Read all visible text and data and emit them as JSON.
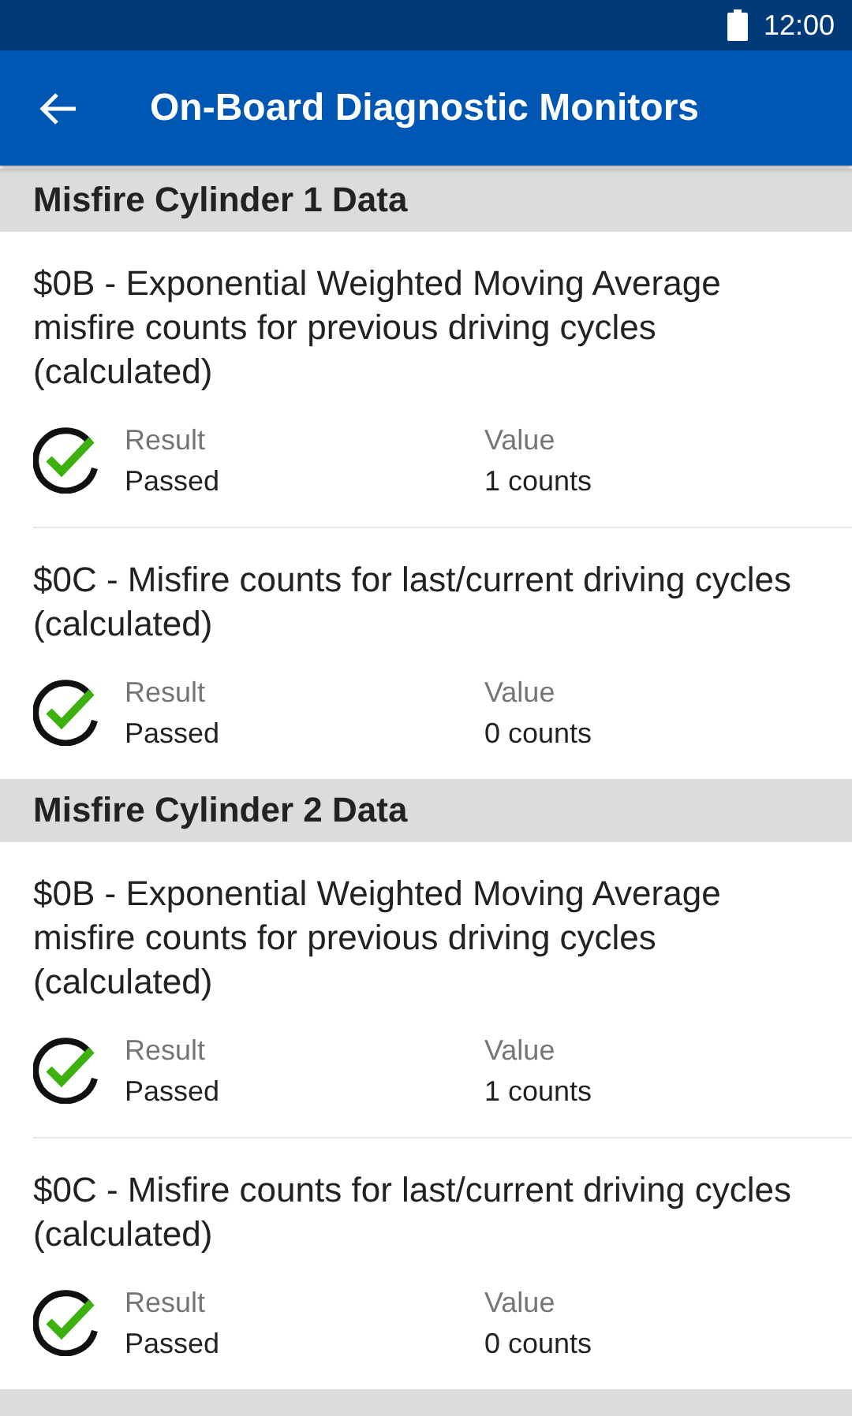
{
  "status_bar": {
    "time": "12:00"
  },
  "app_bar": {
    "title": "On-Board Diagnostic Monitors"
  },
  "sections": [
    {
      "title": "Misfire Cylinder 1 Data",
      "items": [
        {
          "title": "$0B - Exponential Weighted Moving Average misfire counts for previous driving cycles (calculated)",
          "kind": "passed",
          "result_label": "Result",
          "result": "Passed",
          "value_label": "Value",
          "value": "1 counts"
        },
        {
          "title": "$0C - Misfire counts for last/current driving cycles (calculated)",
          "kind": "passed",
          "result_label": "Result",
          "result": "Passed",
          "value_label": "Value",
          "value": "0 counts"
        }
      ]
    },
    {
      "title": "Misfire Cylinder 2 Data",
      "items": [
        {
          "title": "$0B - Exponential Weighted Moving Average misfire counts for previous driving cycles (calculated)",
          "kind": "passed",
          "result_label": "Result",
          "result": "Passed",
          "value_label": "Value",
          "value": "1 counts"
        },
        {
          "title": "$0C - Misfire counts for last/current driving cycles (calculated)",
          "kind": "passed",
          "result_label": "Result",
          "result": "Passed",
          "value_label": "Value",
          "value": "0 counts"
        }
      ]
    },
    {
      "kind": "cut_off"
    }
  ]
}
